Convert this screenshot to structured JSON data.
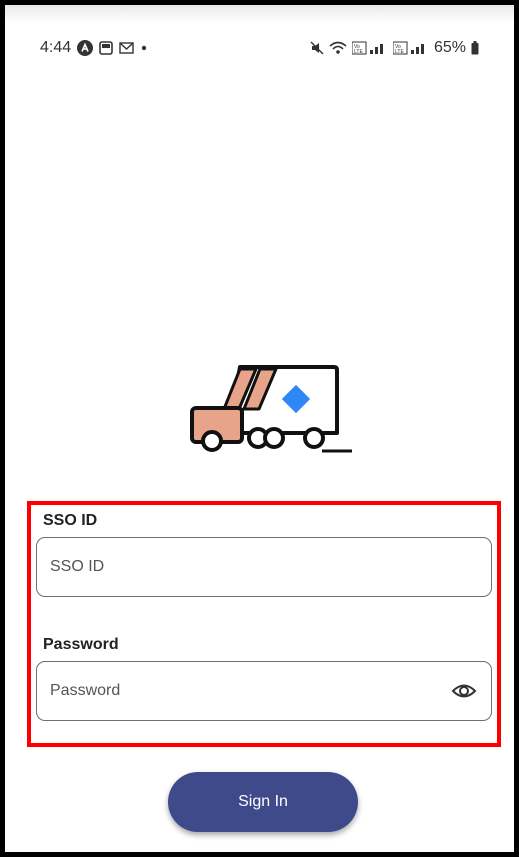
{
  "status_bar": {
    "time": "4:44",
    "left_icons": [
      "app-a-icon",
      "gallery-icon",
      "gmail-icon",
      "dot-icon"
    ],
    "right_icons": [
      "mute-icon",
      "wifi-icon",
      "volte1-signal-icon",
      "volte2-signal-icon",
      "battery-icon"
    ],
    "battery": "65%"
  },
  "logo": {
    "icon": "delivery-van-icon",
    "colors": {
      "accent": "#2f86f6",
      "cab": "#e8a48a",
      "outline": "#111111"
    }
  },
  "form": {
    "sso_label": "SSO ID",
    "sso_placeholder": "SSO ID",
    "password_label": "Password",
    "password_placeholder": "Password",
    "password_toggle_icon": "eye-icon",
    "highlight_color": "#ff0000"
  },
  "actions": {
    "sign_in_label": "Sign In",
    "button_color": "#3e4a8a"
  }
}
